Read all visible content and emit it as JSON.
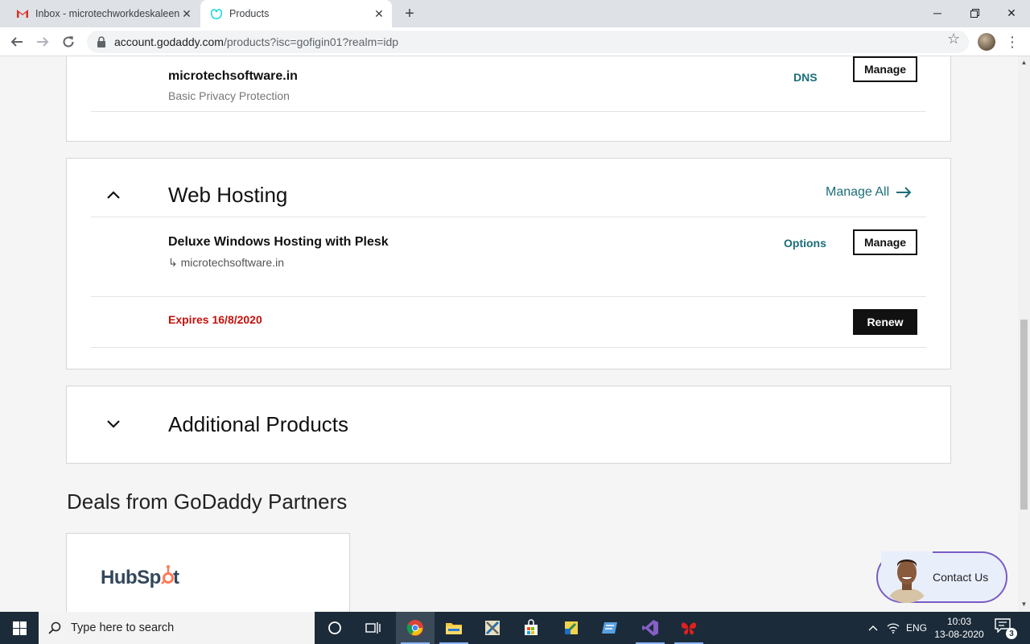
{
  "browser": {
    "tabs": [
      {
        "title": "Inbox - microtechworkdeskaleen",
        "favicon": "gmail-icon",
        "active": false
      },
      {
        "title": "Products",
        "favicon": "godaddy-icon",
        "active": true
      }
    ],
    "url_host": "account.godaddy.com",
    "url_rest": "/products?isc=gofigin01?realm=idp"
  },
  "domain_card": {
    "name": "microtechsoftware.in",
    "subtitle": "Basic Privacy Protection",
    "dns_label": "DNS",
    "manage_label": "Manage"
  },
  "hosting_card": {
    "section_title": "Web Hosting",
    "manage_all_label": "Manage All",
    "product_name": "Deluxe Windows Hosting with Plesk",
    "linked_domain_arrow": "↳",
    "linked_domain": "microtechsoftware.in",
    "options_label": "Options",
    "manage_label": "Manage",
    "expires_label": "Expires 16/8/2020",
    "renew_label": "Renew"
  },
  "additional_card": {
    "section_title": "Additional Products"
  },
  "deals": {
    "title": "Deals from GoDaddy Partners",
    "partner_logo_text": "HubSpot"
  },
  "contact": {
    "label": "Contact Us"
  },
  "taskbar": {
    "search_placeholder": "Type here to search",
    "language": "ENG",
    "time": "10:03",
    "date": "13-08-2020",
    "notification_count": "3"
  },
  "colors": {
    "accent_teal": "#1b6e79",
    "expiry_red": "#c4110c",
    "taskbar_bg": "#1b2b3a"
  }
}
